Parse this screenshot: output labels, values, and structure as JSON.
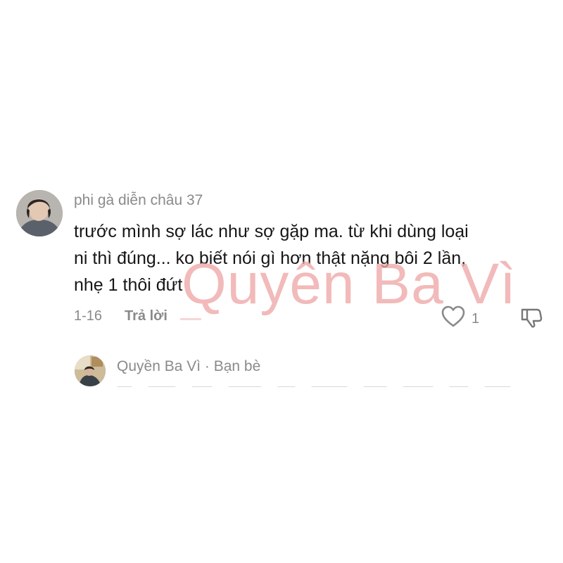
{
  "comment": {
    "username": "phi gà diễn châu 37",
    "text_lines": [
      "trước mình sợ lác như sợ gặp ma. từ khi dùng loại",
      "ni thì đúng... ko biết nói gì hơn thật nặng bôi 2 lần,",
      "nhẹ 1 thôi đứt"
    ],
    "date": "1-16",
    "reply_label": "Trả lời",
    "like_count": "1"
  },
  "reply": {
    "name_line": "Quyền Ba Vì · Bạn bè"
  },
  "watermark": "Quyên Ba Vì",
  "icons": {
    "like": "heart-outline-icon",
    "dislike": "thumb-down-icon"
  },
  "colors": {
    "meta": "#8a8a8a",
    "text": "#161616",
    "watermark": "#eea3a3"
  }
}
